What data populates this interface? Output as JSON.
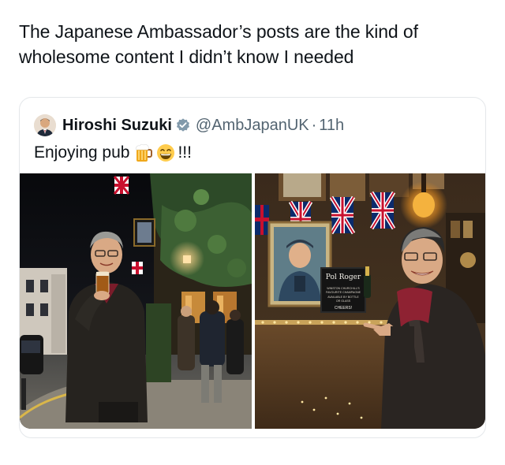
{
  "caption": "The Japanese Ambassador’s posts are the kind of wholesome content I didn’t know I needed",
  "quoted_post": {
    "author_name": "Hiroshi Suzuki",
    "handle": "@AmbJapanUK",
    "separator": "·",
    "time": "11h",
    "text": "Enjoying pub",
    "text_suffix": "!!!",
    "emojis": [
      "beer-mug-icon",
      "grinning-face-icon"
    ],
    "verified": true
  },
  "photos": {
    "right_sign_title": "Pol Roger",
    "right_sign_line1": "WINSTON CHURCHILL'S",
    "right_sign_line2": "FAVOURITE CHAMPAGNE",
    "right_sign_line3": "AVAILABLE BY BOTTLE",
    "right_sign_line4": "OR GLASS",
    "right_sign_cheers": "CHEERS!"
  },
  "colors": {
    "text": "#0f1419",
    "secondary_text": "#536471",
    "card_border": "#e4e7ea",
    "verified_badge": "#829aab"
  }
}
